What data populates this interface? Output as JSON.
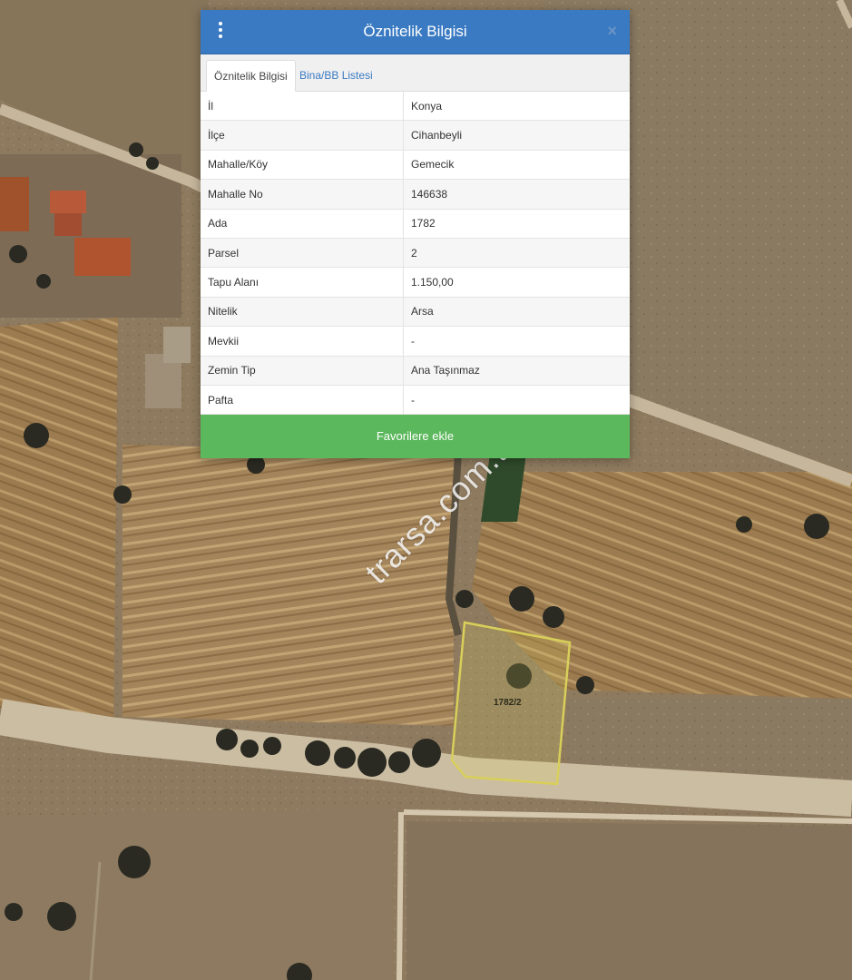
{
  "popup": {
    "title": "Öznitelik Bilgisi",
    "close_symbol": "×",
    "menu_icon": "vertical-dots-icon",
    "tabs": [
      {
        "label": "Öznitelik Bilgisi",
        "active": true
      },
      {
        "label": "Bina/BB Listesi",
        "active": false
      }
    ],
    "rows": [
      {
        "key": "İl",
        "value": "Konya"
      },
      {
        "key": "İlçe",
        "value": "Cihanbeyli"
      },
      {
        "key": "Mahalle/Köy",
        "value": "Gemecik"
      },
      {
        "key": "Mahalle No",
        "value": "146638"
      },
      {
        "key": "Ada",
        "value": "1782"
      },
      {
        "key": "Parsel",
        "value": "2"
      },
      {
        "key": "Tapu Alanı",
        "value": "1.150,00"
      },
      {
        "key": "Nitelik",
        "value": "Arsa"
      },
      {
        "key": "Mevkii",
        "value": "-"
      },
      {
        "key": "Zemin Tip",
        "value": "Ana Taşınmaz"
      },
      {
        "key": "Pafta",
        "value": "-"
      }
    ],
    "favorite_button": "Favorilere ekle"
  },
  "map": {
    "parcel_label": "1782/2",
    "watermark": "trarsa.com.tr"
  },
  "colors": {
    "header": "#3a7ac2",
    "button": "#5cb85c",
    "parcel_outline": "#d8cf5a"
  }
}
